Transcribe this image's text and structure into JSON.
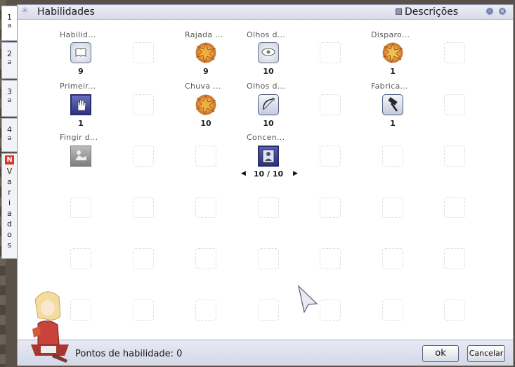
{
  "side_tabs": [
    {
      "num": "1",
      "sup": "a"
    },
    {
      "num": "2",
      "sup": "a"
    },
    {
      "num": "3",
      "sup": "a"
    },
    {
      "num": "4",
      "sup": "a"
    }
  ],
  "variados_tab": {
    "badge": "N",
    "chars": [
      "V",
      "a",
      "r",
      "i",
      "a",
      "d",
      "o",
      "s"
    ]
  },
  "window": {
    "title": "Habilidades",
    "descriptions_label": "Descrições",
    "descriptions_checked": true
  },
  "skills": [
    {
      "name": "Habilid...",
      "level": "9",
      "icon": "book-icon"
    },
    {
      "name": "Rajada ...",
      "level": "9",
      "icon": "burst-icon"
    },
    {
      "name": "Olhos d...",
      "level": "10",
      "icon": "eye-icon"
    },
    {
      "name": "Disparo...",
      "level": "1",
      "icon": "burst-icon"
    },
    {
      "name": "Primeir...",
      "level": "1",
      "icon": "hand-icon"
    },
    {
      "name": "Chuva ...",
      "level": "10",
      "icon": "burst-icon"
    },
    {
      "name": "Olhos d...",
      "level": "10",
      "icon": "bow-icon"
    },
    {
      "name": "Fabrica...",
      "level": "1",
      "icon": "hammer-icon"
    },
    {
      "name": "Fingir d...",
      "level": "",
      "icon": "fake-icon"
    },
    {
      "name": "Concen...",
      "level": "10 / 10",
      "icon": "concentration-icon"
    }
  ],
  "footer": {
    "points_label": "Pontos de habilidade: 0",
    "ok_label": "ok",
    "cancel_label": "Cancelar"
  },
  "colors": {
    "accent": "#7b86ad",
    "titlebar": "#d7dbea",
    "badge": "#d8382a"
  }
}
